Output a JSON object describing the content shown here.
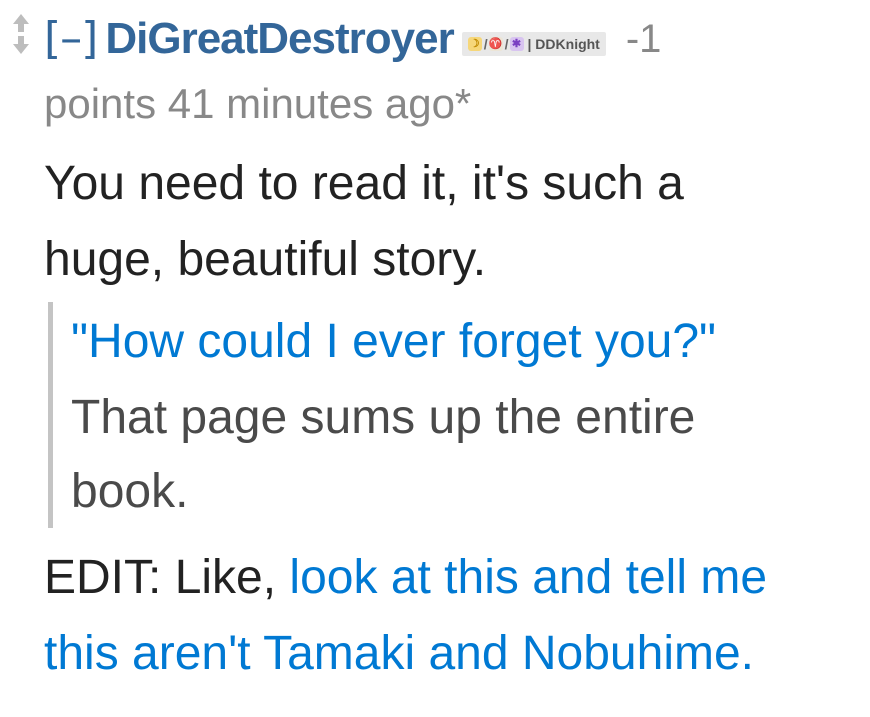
{
  "comment": {
    "expand_label": "[–]",
    "author": "DiGreatDestroyer",
    "flair": {
      "icons": [
        "crescent-icon",
        "goat-icon",
        "alien-monster-icon"
      ],
      "separator": "/",
      "text": "| DDKnight"
    },
    "score": "-1",
    "timeline": "points 41 minutes ago*",
    "body": {
      "line1": "You need to read it, it's such a",
      "line2": "huge, beautiful story."
    },
    "quote": {
      "line1": "\"How could I ever forget you?\"",
      "line2": "That page sums up the entire",
      "line3": "book."
    },
    "edit": {
      "prefix": "EDIT: Like, ",
      "link_line1": "look at this and tell me",
      "link_line2": "this aren't Tamaki and Nobuhime."
    }
  },
  "colors": {
    "author": "#336699",
    "link": "#0079d3",
    "meta": "#888888",
    "text": "#222222",
    "quote_border": "#c4c4c4"
  }
}
